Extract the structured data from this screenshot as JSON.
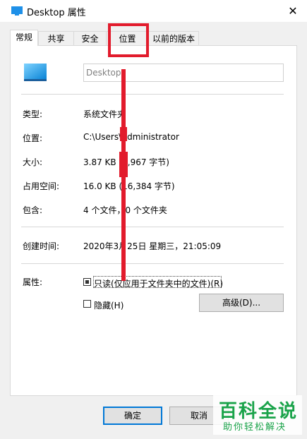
{
  "window": {
    "title": "Desktop 属性",
    "close_glyph": "✕"
  },
  "tabs": [
    {
      "label": "常规",
      "active": true
    },
    {
      "label": "共享"
    },
    {
      "label": "安全"
    },
    {
      "label": "位置"
    },
    {
      "label": "以前的版本"
    }
  ],
  "general": {
    "name_value": "Desktop",
    "type_label": "类型:",
    "type_value": "系统文件夹",
    "location_label": "位置:",
    "location_value": "C:\\Users\\Administrator",
    "size_label": "大小:",
    "size_value": "3.87 KB (3,967 字节)",
    "disk_label": "占用空间:",
    "disk_value": "16.0 KB (16,384 字节)",
    "contains_label": "包含:",
    "contains_value": "4 个文件，0 个文件夹",
    "created_label": "创建时间:",
    "created_value": "2020年3月25日 星期三，21:05:09",
    "attributes_label": "属性:",
    "readonly_label": "只读(仅应用于文件夹中的文件)(R)",
    "hidden_label": "隐藏(H)",
    "advanced_label": "高级(D)..."
  },
  "footer": {
    "ok_label": "确定",
    "cancel_label": "取消"
  },
  "watermark": {
    "main": "百科全说",
    "sub": "助你轻松解决"
  },
  "colors": {
    "annotation": "#e21b2c",
    "accent": "#0078d7",
    "watermark": "#1aa34a"
  },
  "icons": {
    "title": "folder-icon",
    "desktop": "monitor-icon"
  }
}
